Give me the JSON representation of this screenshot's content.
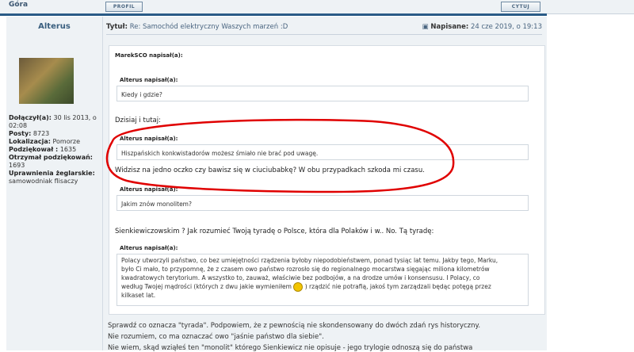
{
  "topbar": {
    "gora": "Góra",
    "profil_button": "PROFIL",
    "cytuj_button": "CYTUJ"
  },
  "author": {
    "name": "Alterus",
    "stats": {
      "joined_label": "Dołączył(a):",
      "joined_value": "30 lis 2013, o 02:08",
      "posts_label": "Posty:",
      "posts_value": "8723",
      "location_label": "Lokalizacja:",
      "location_value": "Pomorze",
      "thanked_label": "Podziękował :",
      "thanked_value": "1635",
      "received_label": "Otrzymał podziękowań:",
      "received_value": "1693",
      "rights_label": "Uprawnienia żeglarskie:",
      "rights_value": "samowodniak flisaczy"
    }
  },
  "post": {
    "title_label": "Tytuł:",
    "title": "Re: Samochód elektryczny Waszych marzeń :D",
    "date_label": "Napisane:",
    "date": "24 cze 2019, o 19:13"
  },
  "quotes": {
    "outer_label": "MarekSCO napisał(a):",
    "q1_label": "Alterus napisał(a):",
    "q1_text": "Kiedy i gdzie?",
    "dzisiaj": "Dzisiaj i tutaj:",
    "q2_label": "Alterus napisał(a):",
    "q2_text": "Hiszpańskich konkwistadorów możesz śmiało nie brać pod uwagę.",
    "widzisz": "Widzisz na jedno oczko czy bawisz się w ciuciubabkę? W obu przypadkach szkoda mi czasu.",
    "q3_label": "Alterus napisał(a):",
    "q3_text": "Jakim znów monolitem?",
    "sienk": "Sienkiewiczowskim ? Jak rozumieć Twoją tyradę o Polsce, która dla Polaków i w.. No. Tą tyradę:",
    "q4_label": "Alterus napisał(a):",
    "q4_text1": "Polacy utworzyli państwo, co bez umiejętności rządzenia byłoby niepodobieństwem, ponad tysiąc lat temu. Jakby tego, Marku,",
    "q4_text2": "było Ci mało, to przypomnę, że z czasem owo państwo rozrosło się do regionalnego mocarstwa sięgając miliona kilometrów",
    "q4_text3": "kwadratowych terytorium. A wszystko to, zauważ, właściwie bez podbojów, a na drodze umów i konsensusu. I Polacy, co",
    "q4_text4a": "według Twojej mądrości (których z dwu jakie wymieniłem",
    "q4_text4b": ") rządzić nie potrafią, jakoś tym zarządzali będąc potęgą przez",
    "q4_text5": "kilkaset lat."
  },
  "after": {
    "line1": "Sprawdź co oznacza \"tyrada\". Podpowiem, że z pewnością nie skondensowany do dwóch zdań rys historyczny.",
    "line2": "Nie rozumiem, co ma oznaczać owo \"jaśnie państwo dla siebie\".",
    "line3": "Nie wiem, skąd wziąłeś ten \"monolit\" którego Sienkiewicz nie opisuje - jego trylogie odnoszą się do państwa"
  },
  "colors": {
    "accent": "#2a5b86",
    "annotation": "#e00000",
    "panel": "#eef2f5"
  }
}
